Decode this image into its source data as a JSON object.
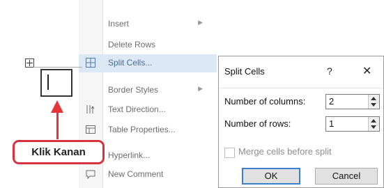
{
  "context_menu": {
    "items": [
      {
        "label": "Insert",
        "icon": "insert-icon",
        "submenu": true
      },
      {
        "label": "Delete Rows",
        "icon": "",
        "submenu": false
      },
      {
        "label": "Split Cells...",
        "icon": "split-cells-icon",
        "submenu": false,
        "selected": true
      },
      {
        "label": "Border Styles",
        "icon": "",
        "submenu": true
      },
      {
        "label": "Text Direction...",
        "icon": "text-direction-icon",
        "submenu": false
      },
      {
        "label": "Table Properties...",
        "icon": "table-properties-icon",
        "submenu": false
      },
      {
        "label": "Hyperlink...",
        "icon": "hyperlink-icon",
        "submenu": false
      },
      {
        "label": "New Comment",
        "icon": "comment-icon",
        "submenu": false
      }
    ]
  },
  "callout": {
    "label": "Klik Kanan",
    "color": "#e3353a"
  },
  "dialog": {
    "title": "Split Cells",
    "help": "?",
    "close": "✕",
    "columns_label": "Number of columns:",
    "columns_value": "2",
    "rows_label": "Number of rows:",
    "rows_value": "1",
    "merge_label": "Merge cells before split",
    "merge_checked": false,
    "ok_label": "OK",
    "cancel_label": "Cancel"
  },
  "colors": {
    "accent": "#3c7fd1",
    "highlight": "#dce8f6"
  }
}
